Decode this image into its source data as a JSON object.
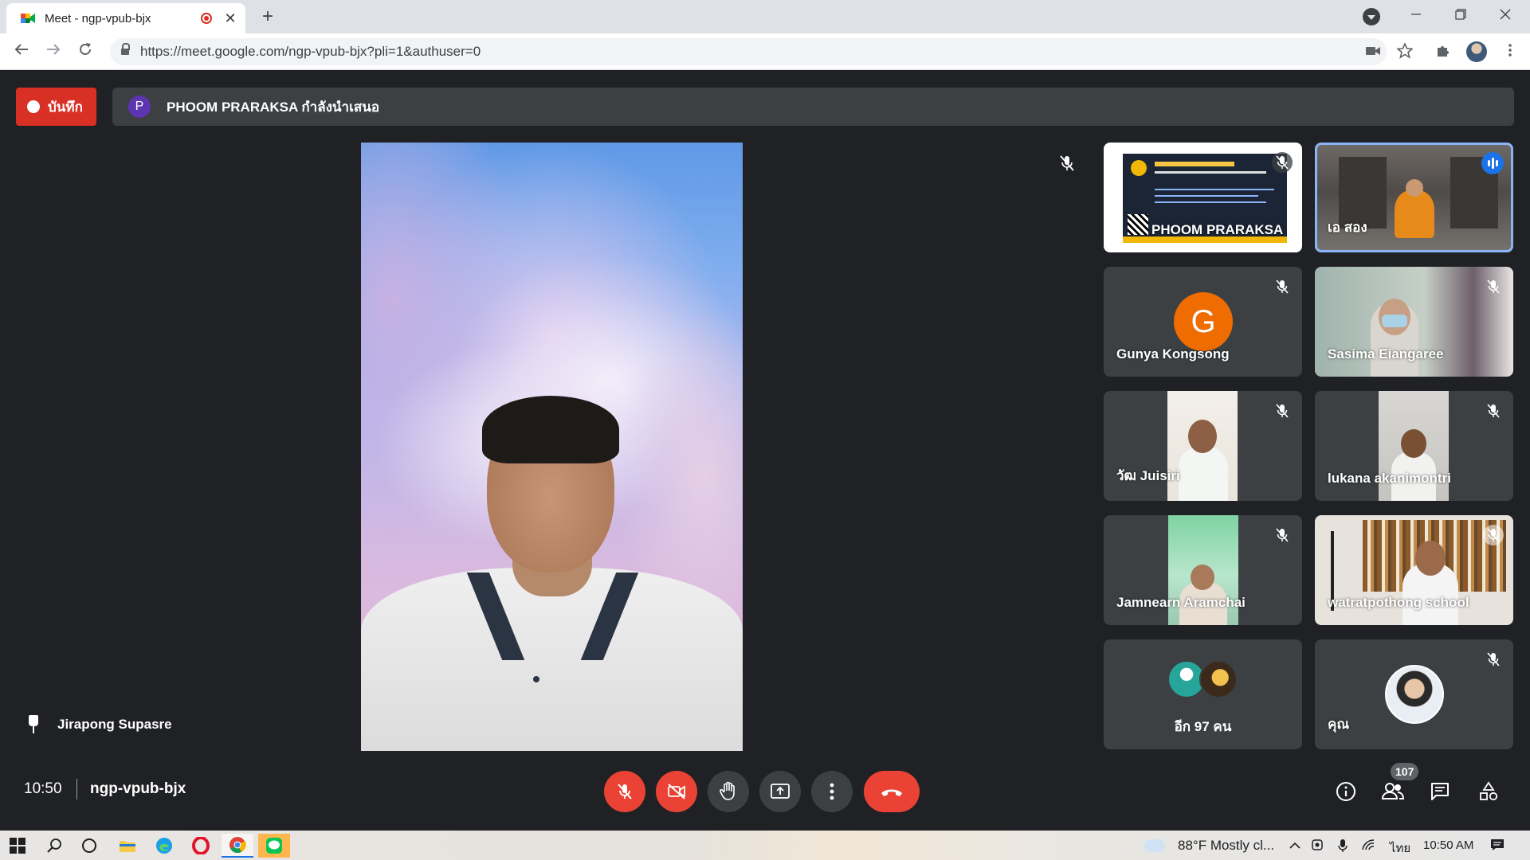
{
  "browser": {
    "tab_title": "Meet - ngp-vpub-bjx",
    "tab_close": "✕",
    "new_tab": "+",
    "url": "https://meet.google.com/ngp-vpub-bjx?pli=1&authuser=0"
  },
  "meet": {
    "record_label": "บันทึก",
    "presenter_initial": "P",
    "presenting_text": "PHOOM PRARAKSA กำลังนำเสนอ",
    "pinned_name": "Jirapong Supasre",
    "meeting_time": "10:50",
    "meeting_code": "ngp-vpub-bjx",
    "people_count": "107",
    "tiles": [
      {
        "name": "PHOOM PRARAKSA",
        "muted": true
      },
      {
        "name": "เอ สอง",
        "speaking": true
      },
      {
        "name": "Gunya Kongsong",
        "initial": "G",
        "avatar_color": "#ef6c00",
        "muted": true
      },
      {
        "name": "Sasima Eiangaree",
        "muted": true
      },
      {
        "name": "วัฒ Juisiri",
        "muted": true
      },
      {
        "name": "lukana akanimontri",
        "muted": true
      },
      {
        "name": "Jamnearn Aramchai",
        "muted": true
      },
      {
        "name": "watratpothong school",
        "muted": true
      },
      {
        "name": "อีก 97 คน"
      },
      {
        "name": "คุณ",
        "muted": true
      }
    ]
  },
  "taskbar": {
    "weather": "88°F  Mostly cl...",
    "language": "ไทย",
    "clock": "10:50 AM"
  },
  "colors": {
    "accent_red": "#ea4335",
    "record_red": "#d93025",
    "tile_bg": "#3c4043",
    "page_bg": "#202124",
    "speaking_blue": "#1a73e8"
  }
}
